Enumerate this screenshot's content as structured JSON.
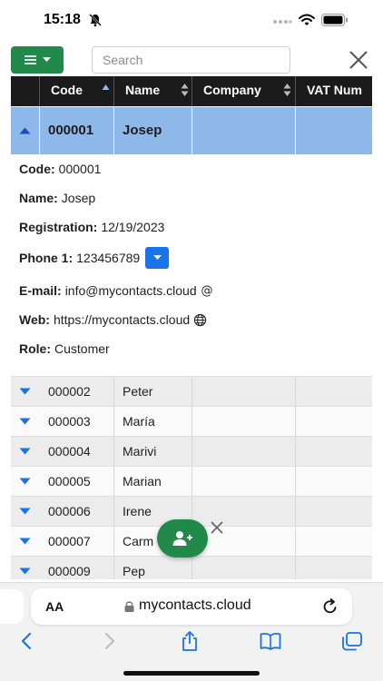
{
  "status_bar": {
    "time": "15:18"
  },
  "toolbar": {
    "search_placeholder": "Search"
  },
  "grid": {
    "columns": [
      "Code",
      "Name",
      "Company",
      "VAT Num"
    ],
    "selected_row": {
      "code": "000001",
      "name": "Josep",
      "company": "",
      "vat": ""
    },
    "detail": {
      "code_label": "Code:",
      "code_value": "000001",
      "name_label": "Name:",
      "name_value": "Josep",
      "registration_label": "Registration:",
      "registration_value": "12/19/2023",
      "phone_label": "Phone 1:",
      "phone_value": "123456789",
      "email_label": "E-mail:",
      "email_value": "info@mycontacts.cloud",
      "web_label": "Web:",
      "web_value": "https://mycontacts.cloud",
      "role_label": "Role:",
      "role_value": "Customer"
    },
    "rows": [
      {
        "code": "000002",
        "name": "Peter"
      },
      {
        "code": "000003",
        "name": "María"
      },
      {
        "code": "000004",
        "name": "Marivi"
      },
      {
        "code": "000005",
        "name": "Marian"
      },
      {
        "code": "000006",
        "name": "Irene"
      },
      {
        "code": "000007",
        "name": "Carm"
      },
      {
        "code": "000009",
        "name": "Pep"
      }
    ]
  },
  "browser": {
    "aa_label": "AA",
    "url": "mycontacts.cloud"
  },
  "colors": {
    "accent_green": "#218a4a",
    "selection_blue": "#8fb8ea",
    "link_blue": "#1a73e8",
    "header_dark": "#1b1b1b"
  }
}
